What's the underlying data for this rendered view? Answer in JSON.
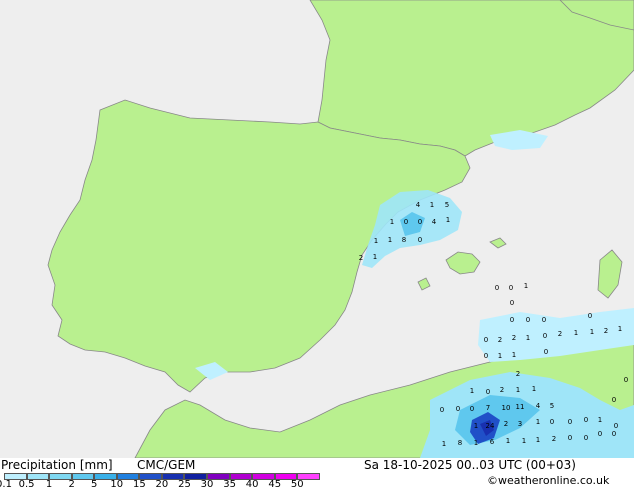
{
  "legend": {
    "title": "Precipitation [mm]",
    "model": "CMC/GEM",
    "datetime": "Sa 18-10-2025 00..03 UTC (00+03)",
    "credit": "©weatheronline.co.uk",
    "ticks": [
      "0.1",
      "0.5",
      "1",
      "2",
      "5",
      "10",
      "15",
      "20",
      "25",
      "30",
      "35",
      "40",
      "45",
      "50"
    ],
    "colors": [
      "#bff0ff",
      "#9fe5f8",
      "#7fd8f2",
      "#5fc8ee",
      "#3ab0e8",
      "#2080e0",
      "#2050c8",
      "#1830b0",
      "#1020a0",
      "#8000c0",
      "#b000d0",
      "#d000e0",
      "#ee00f0",
      "#ff40ff"
    ]
  },
  "map": {
    "land_color": "#b9f08f",
    "sea_color": "#eeeeee",
    "values": [
      {
        "t": "4"
      },
      {
        "t": "1"
      },
      {
        "t": "5"
      },
      {
        "t": "1"
      },
      {
        "t": "0"
      },
      {
        "t": "0"
      },
      {
        "t": "4"
      },
      {
        "t": "1"
      },
      {
        "t": "1"
      },
      {
        "t": "1"
      },
      {
        "t": "8"
      },
      {
        "t": "0"
      },
      {
        "t": "2"
      },
      {
        "t": "1"
      },
      {
        "t": "0"
      },
      {
        "t": "0"
      },
      {
        "t": "1"
      },
      {
        "t": "0"
      },
      {
        "t": "0"
      },
      {
        "t": "0"
      },
      {
        "t": "0"
      },
      {
        "t": "0"
      },
      {
        "t": "0"
      },
      {
        "t": "2"
      },
      {
        "t": "2"
      },
      {
        "t": "1"
      },
      {
        "t": "0"
      },
      {
        "t": "2"
      },
      {
        "t": "1"
      },
      {
        "t": "1"
      },
      {
        "t": "2"
      },
      {
        "t": "1"
      },
      {
        "t": "0"
      },
      {
        "t": "1"
      },
      {
        "t": "1"
      },
      {
        "t": "0"
      },
      {
        "t": "2"
      },
      {
        "t": "1"
      },
      {
        "t": "0"
      },
      {
        "t": "2"
      },
      {
        "t": "1"
      },
      {
        "t": "1"
      },
      {
        "t": "0"
      },
      {
        "t": "0"
      },
      {
        "t": "0"
      },
      {
        "t": "7"
      },
      {
        "t": "10"
      },
      {
        "t": "11"
      },
      {
        "t": "4"
      },
      {
        "t": "5"
      },
      {
        "t": "1"
      },
      {
        "t": "24"
      },
      {
        "t": "2"
      },
      {
        "t": "3"
      },
      {
        "t": "1"
      },
      {
        "t": "0"
      },
      {
        "t": "0"
      },
      {
        "t": "0"
      },
      {
        "t": "1"
      },
      {
        "t": "1"
      },
      {
        "t": "8"
      },
      {
        "t": "1"
      },
      {
        "t": "6"
      },
      {
        "t": "1"
      },
      {
        "t": "1"
      },
      {
        "t": "1"
      },
      {
        "t": "2"
      },
      {
        "t": "0"
      },
      {
        "t": "0"
      },
      {
        "t": "0"
      },
      {
        "t": "0"
      },
      {
        "t": "0"
      },
      {
        "t": "0"
      },
      {
        "t": "0"
      },
      {
        "t": "2"
      },
      {
        "t": "2"
      },
      {
        "t": "5"
      },
      {
        "t": "2"
      }
    ]
  }
}
